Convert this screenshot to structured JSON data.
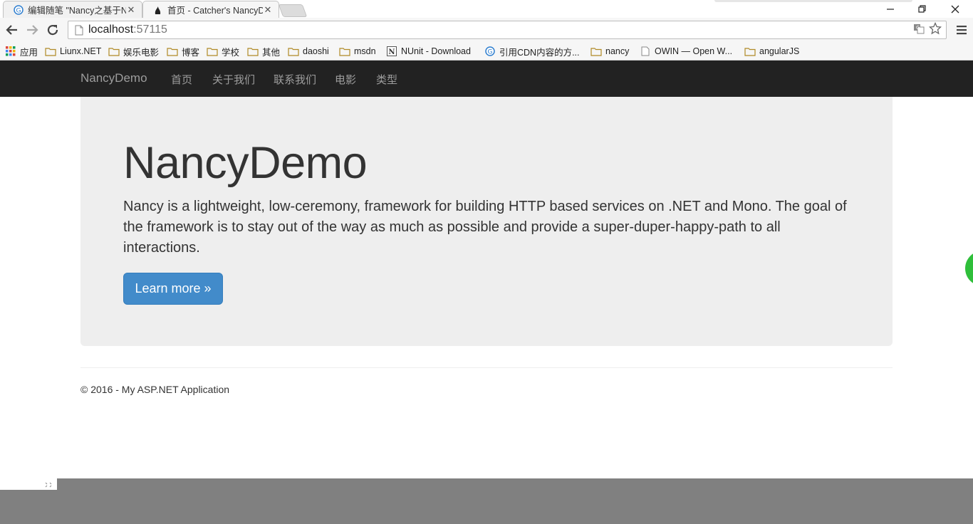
{
  "browser": {
    "tabs": [
      {
        "title": "编辑随笔 \"Nancy之基于N",
        "icon": "blog-icon",
        "active": false
      },
      {
        "title": "首页 - Catcher's NancyD",
        "icon": "nancy-icon",
        "active": true
      }
    ],
    "address": {
      "host": "localhost",
      "port": ":57115"
    },
    "bookmarks": [
      {
        "label": "应用",
        "icon": "apps-grid-icon"
      },
      {
        "label": "Liunx.NET",
        "icon": "folder-icon"
      },
      {
        "label": "娱乐电影",
        "icon": "folder-icon"
      },
      {
        "label": "博客",
        "icon": "folder-icon"
      },
      {
        "label": "学校",
        "icon": "folder-icon"
      },
      {
        "label": "其他",
        "icon": "folder-icon"
      },
      {
        "label": "daoshi",
        "icon": "folder-icon"
      },
      {
        "label": "msdn",
        "icon": "folder-icon"
      },
      {
        "label": "NUnit - Download",
        "icon": "nunit-icon"
      },
      {
        "label": "引用CDN内容的方...",
        "icon": "globe-icon"
      },
      {
        "label": "nancy",
        "icon": "folder-icon"
      },
      {
        "label": "OWIN — Open W...",
        "icon": "page-icon"
      },
      {
        "label": "angularJS",
        "icon": "folder-icon"
      }
    ]
  },
  "navbar": {
    "brand": "NancyDemo",
    "links": [
      "首页",
      "关于我们",
      "联系我们",
      "电影",
      "类型"
    ]
  },
  "jumbotron": {
    "title": "NancyDemo",
    "lead": "Nancy is a lightweight, low-ceremony, framework for building HTTP based services on .NET and Mono. The goal of the framework is to stay out of the way as much as possible and provide a super-duper-happy-path to all interactions.",
    "button": "Learn more »"
  },
  "footer": {
    "text": "© 2016 - My ASP.NET Application"
  },
  "colors": {
    "navbar_bg": "#222222",
    "navbar_text": "#9d9d9d",
    "jumbotron_bg": "#eeeeee",
    "primary": "#428bca",
    "folder": "#e8c15a"
  }
}
